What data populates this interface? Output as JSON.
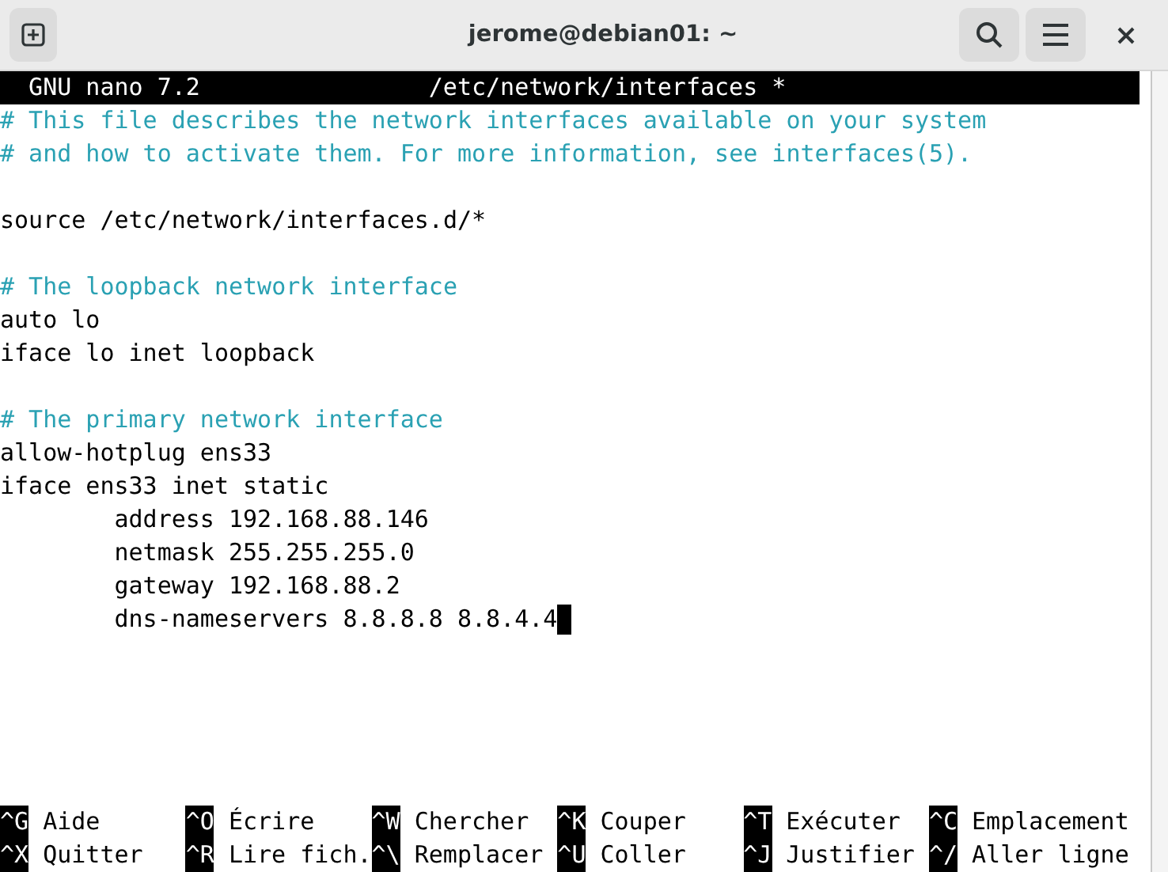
{
  "window": {
    "title": "jerome@debian01: ~"
  },
  "nano_header": {
    "program": "GNU nano 7.2",
    "filename": "/etc/network/interfaces *"
  },
  "lines": [
    {
      "kind": "comment",
      "text": "# This file describes the network interfaces available on your system"
    },
    {
      "kind": "comment",
      "text": "# and how to activate them. For more information, see interfaces(5)."
    },
    {
      "kind": "blank"
    },
    {
      "kind": "code",
      "text": "source /etc/network/interfaces.d/*"
    },
    {
      "kind": "blank"
    },
    {
      "kind": "comment",
      "text": "# The loopback network interface"
    },
    {
      "kind": "code",
      "text": "auto lo"
    },
    {
      "kind": "code",
      "text": "iface lo inet loopback"
    },
    {
      "kind": "blank"
    },
    {
      "kind": "comment",
      "text": "# The primary network interface"
    },
    {
      "kind": "code",
      "text": "allow-hotplug ens33"
    },
    {
      "kind": "code",
      "text": "iface ens33 inet static"
    },
    {
      "kind": "code",
      "text": "        address 192.168.88.146"
    },
    {
      "kind": "code",
      "text": "        netmask 255.255.255.0"
    },
    {
      "kind": "code",
      "text": "        gateway 192.168.88.2"
    },
    {
      "kind": "code",
      "text": "        dns-nameservers 8.8.8.8 8.8.4.4",
      "cursor": true
    }
  ],
  "shortcuts": [
    [
      {
        "key": "^G",
        "label": "Aide"
      },
      {
        "key": "^O",
        "label": "Écrire"
      },
      {
        "key": "^W",
        "label": "Chercher"
      },
      {
        "key": "^K",
        "label": "Couper"
      },
      {
        "key": "^T",
        "label": "Exécuter"
      },
      {
        "key": "^C",
        "label": "Emplacement"
      }
    ],
    [
      {
        "key": "^X",
        "label": "Quitter"
      },
      {
        "key": "^R",
        "label": "Lire fich."
      },
      {
        "key": "^\\",
        "label": "Remplacer"
      },
      {
        "key": "^U",
        "label": "Coller"
      },
      {
        "key": "^J",
        "label": "Justifier"
      },
      {
        "key": "^/",
        "label": "Aller ligne"
      }
    ]
  ]
}
